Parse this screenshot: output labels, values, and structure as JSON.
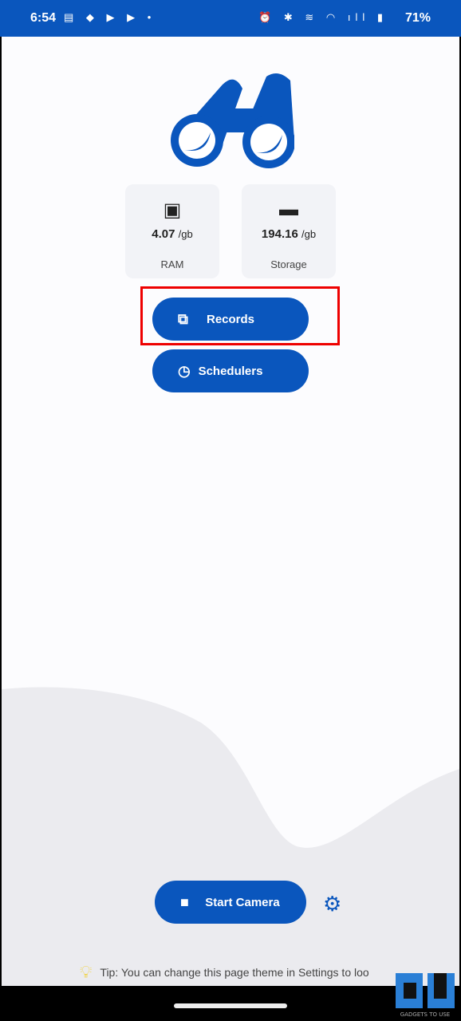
{
  "status_bar": {
    "time": "6:54",
    "battery": "71%",
    "left_icons": [
      "news-icon",
      "location-icon",
      "youtube-icon",
      "youtube-icon",
      "dot-icon"
    ],
    "right_icons": [
      "alarm-icon",
      "bluetooth-icon",
      "volte-icon",
      "wifi-icon",
      "signal-icon",
      "battery-icon"
    ]
  },
  "cards": [
    {
      "icon": "chip-icon",
      "value": "4.07",
      "unit": "/gb",
      "label": "RAM"
    },
    {
      "icon": "storage-icon",
      "value": "194.16",
      "unit": "/gb",
      "label": "Storage"
    }
  ],
  "buttons": {
    "records": "Records",
    "schedulers": "Schedulers",
    "start_camera": "Start Camera"
  },
  "tip": "Tip: You can change this page theme in Settings to loo",
  "watermark": "GADGETS TO USE",
  "colors": {
    "accent": "#0a56bd",
    "highlight": "#e00000"
  }
}
